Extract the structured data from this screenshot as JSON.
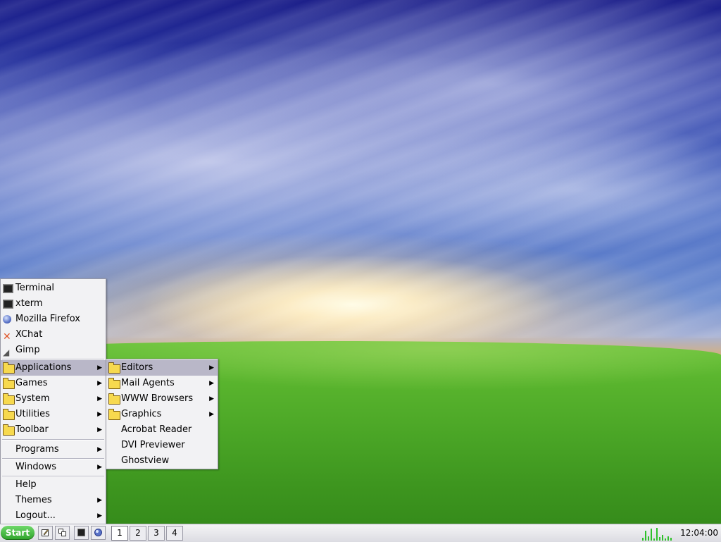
{
  "menu": {
    "quick_items": [
      {
        "label": "Terminal",
        "icon": "terminal-icon"
      },
      {
        "label": "xterm",
        "icon": "terminal-icon"
      },
      {
        "label": "Mozilla Firefox",
        "icon": "globe-icon"
      },
      {
        "label": "XChat",
        "icon": "xchat-icon"
      },
      {
        "label": "Gimp",
        "icon": "gimp-icon"
      }
    ],
    "folders": [
      {
        "label": "Applications"
      },
      {
        "label": "Games"
      },
      {
        "label": "System"
      },
      {
        "label": "Utilities"
      },
      {
        "label": "Toolbar"
      }
    ],
    "programs_label": "Programs",
    "windows_label": "Windows",
    "help_label": "Help",
    "themes_label": "Themes",
    "logout_label": "Logout..."
  },
  "submenu": {
    "folders": [
      {
        "label": "Editors"
      },
      {
        "label": "Mail Agents"
      },
      {
        "label": "WWW Browsers"
      },
      {
        "label": "Graphics"
      }
    ],
    "apps": [
      {
        "label": "Acrobat Reader"
      },
      {
        "label": "DVI Previewer"
      },
      {
        "label": "Ghostview"
      }
    ]
  },
  "taskbar": {
    "start_label": "Start",
    "workspaces": [
      "1",
      "2",
      "3",
      "4"
    ],
    "active_workspace": "1",
    "clock": "12:04:00"
  },
  "colors": {
    "menu_bg": "#f2f2f4",
    "highlight": "#b9b7c8",
    "start_button": "#2ea32a"
  }
}
